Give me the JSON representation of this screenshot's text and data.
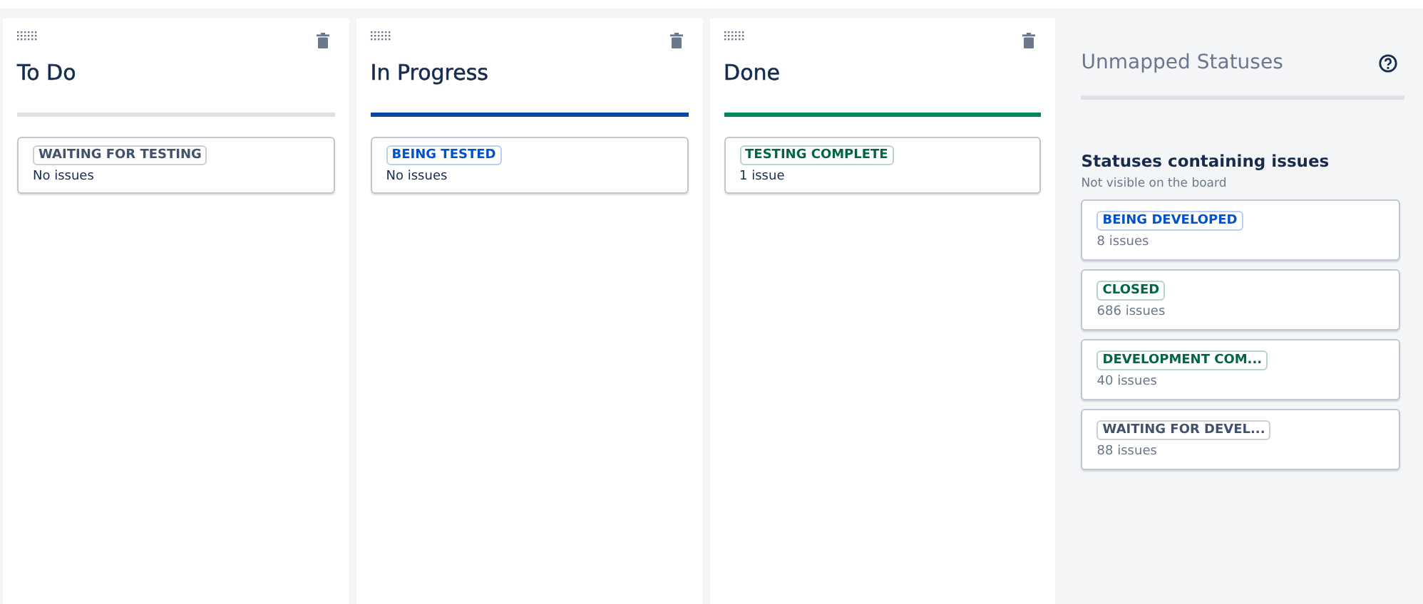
{
  "columns": [
    {
      "title": "To Do",
      "color": "#dfe1e6",
      "statuses": [
        {
          "name": "WAITING FOR TESTING",
          "color": "#42526e",
          "count": "No issues"
        }
      ]
    },
    {
      "title": "In Progress",
      "color": "#0747a6",
      "statuses": [
        {
          "name": "BEING TESTED",
          "color": "#0052cc",
          "count": "No issues"
        }
      ]
    },
    {
      "title": "Done",
      "color": "#00875a",
      "statuses": [
        {
          "name": "TESTING COMPLETE",
          "color": "#006644",
          "count": "1 issue"
        }
      ]
    }
  ],
  "unmapped": {
    "title": "Unmapped Statuses",
    "section_title": "Statuses containing issues",
    "section_subtitle": "Not visible on the board",
    "statuses": [
      {
        "name": "BEING DEVELOPED",
        "color": "#0052cc",
        "count": "8 issues"
      },
      {
        "name": "CLOSED",
        "color": "#006644",
        "count": "686 issues"
      },
      {
        "name": "DEVELOPMENT COM...",
        "color": "#006644",
        "count": "40 issues"
      },
      {
        "name": "WAITING FOR DEVEL...",
        "color": "#42526e",
        "count": "88 issues"
      }
    ]
  }
}
